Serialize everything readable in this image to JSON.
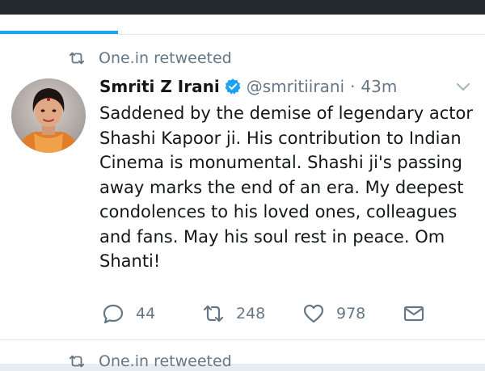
{
  "tweet": {
    "retweet_context": "One.in retweeted",
    "name": "Smriti Z Irani",
    "handle": "@smritiirani",
    "separator": "·",
    "time": "43m",
    "text": "Saddened by the demise of legendary actor Shashi Kapoor ji. His contribution to Indian Cinema is monumental. Shashi ji's passing away marks the end of an era. My deepest condolences to his loved ones, colleagues and fans. May his soul rest in peace. Om Shanti!",
    "actions": {
      "reply_count": "44",
      "retweet_count": "248",
      "like_count": "978"
    },
    "verified": true
  },
  "next_tweet": {
    "retweet_context": "One.in retweeted"
  },
  "icons": {
    "retweet": "retweet-icon",
    "verified": "verified-badge-icon",
    "caret": "chevron-down-icon",
    "reply": "reply-icon",
    "like": "heart-icon",
    "dm": "envelope-icon"
  },
  "colors": {
    "accent": "#1da1f2",
    "muted": "#657786",
    "text": "#14171a",
    "status_bar": "#24292e"
  }
}
